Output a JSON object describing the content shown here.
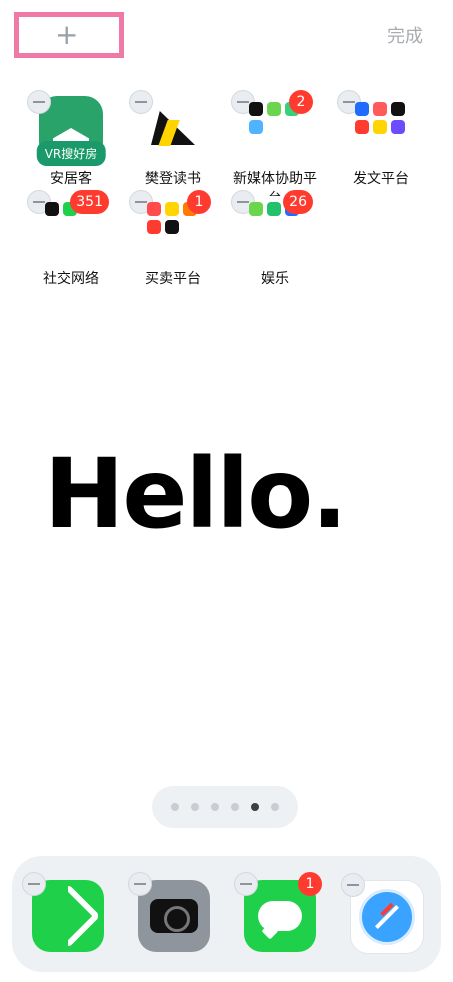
{
  "header": {
    "add_icon": "+",
    "done_label": "完成"
  },
  "apps": [
    {
      "label": "安居客",
      "icon": "anjuke-icon",
      "subtext": "VR搜好房"
    },
    {
      "label": "樊登读书",
      "icon": "fandeng-icon"
    },
    {
      "label": "新媒体协助平台",
      "icon": "folder-icon",
      "badge": "2"
    },
    {
      "label": "发文平台",
      "icon": "folder-icon"
    },
    {
      "label": "社交网络",
      "icon": "folder-icon",
      "badge": "351"
    },
    {
      "label": "买卖平台",
      "icon": "folder-icon",
      "badge": "1"
    },
    {
      "label": "娱乐",
      "icon": "folder-icon",
      "badge": "26"
    }
  ],
  "wallpaper": {
    "text": "Hello."
  },
  "page_indicator": {
    "count": 6,
    "active_index": 4
  },
  "dock": [
    {
      "name": "Phone",
      "icon": "phone-icon"
    },
    {
      "name": "Camera",
      "icon": "camera-icon"
    },
    {
      "name": "Messages",
      "icon": "messages-icon",
      "badge": "1"
    },
    {
      "name": "Safari",
      "icon": "safari-icon"
    }
  ],
  "colors": {
    "badge": "#ff3b30",
    "highlight": "#f07aa6",
    "accent_green": "#1fd14a"
  }
}
